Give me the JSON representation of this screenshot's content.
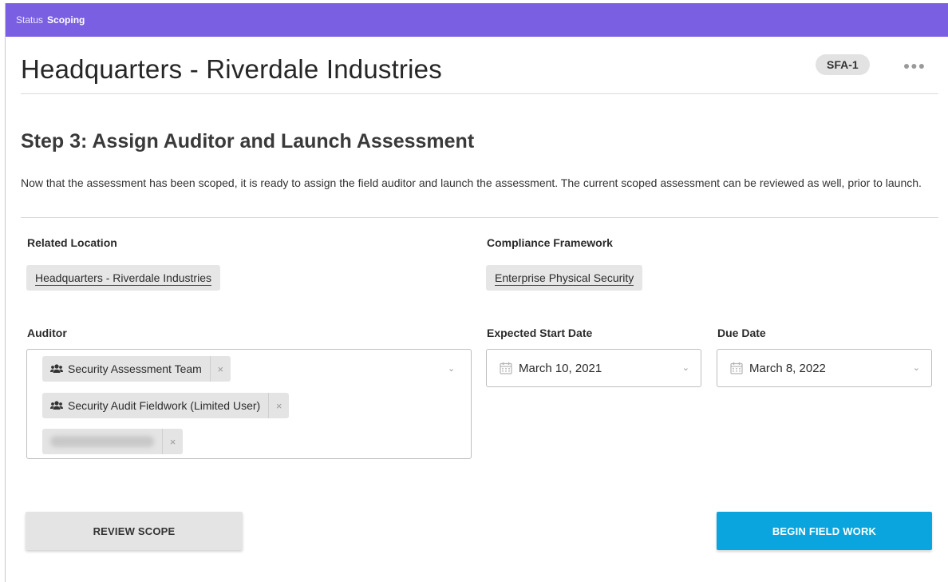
{
  "status": {
    "label": "Status",
    "value": "Scoping"
  },
  "header": {
    "title": "Headquarters - Riverdale Industries",
    "record_id": "SFA-1",
    "more_icon": "ellipsis-icon"
  },
  "step": {
    "title": "Step 3: Assign Auditor and Launch Assessment",
    "description": "Now that the assessment has been scoped, it is ready to assign the field auditor and launch the assessment. The current scoped assessment can be reviewed as well, prior to launch."
  },
  "related_location": {
    "label": "Related Location",
    "value": "Headquarters - Riverdale Industries"
  },
  "compliance_framework": {
    "label": "Compliance Framework",
    "value": "Enterprise Physical Security"
  },
  "auditor": {
    "label": "Auditor",
    "selected": [
      {
        "name": "Security Assessment Team",
        "icon": "users-icon"
      },
      {
        "name": "Security Audit Fieldwork (Limited User)",
        "icon": "users-icon"
      },
      {
        "name": "",
        "blurred": true
      }
    ],
    "remove_glyph": "×"
  },
  "start_date": {
    "label": "Expected Start Date",
    "value": "March 10, 2021",
    "icon": "calendar-icon"
  },
  "due_date": {
    "label": "Due Date",
    "value": "March 8, 2022",
    "icon": "calendar-icon"
  },
  "actions": {
    "review": "REVIEW SCOPE",
    "begin": "BEGIN FIELD WORK"
  },
  "colors": {
    "status_bar": "#7a5fe3",
    "primary_button": "#0aa5de",
    "chip_bg": "#e6e6e6"
  }
}
